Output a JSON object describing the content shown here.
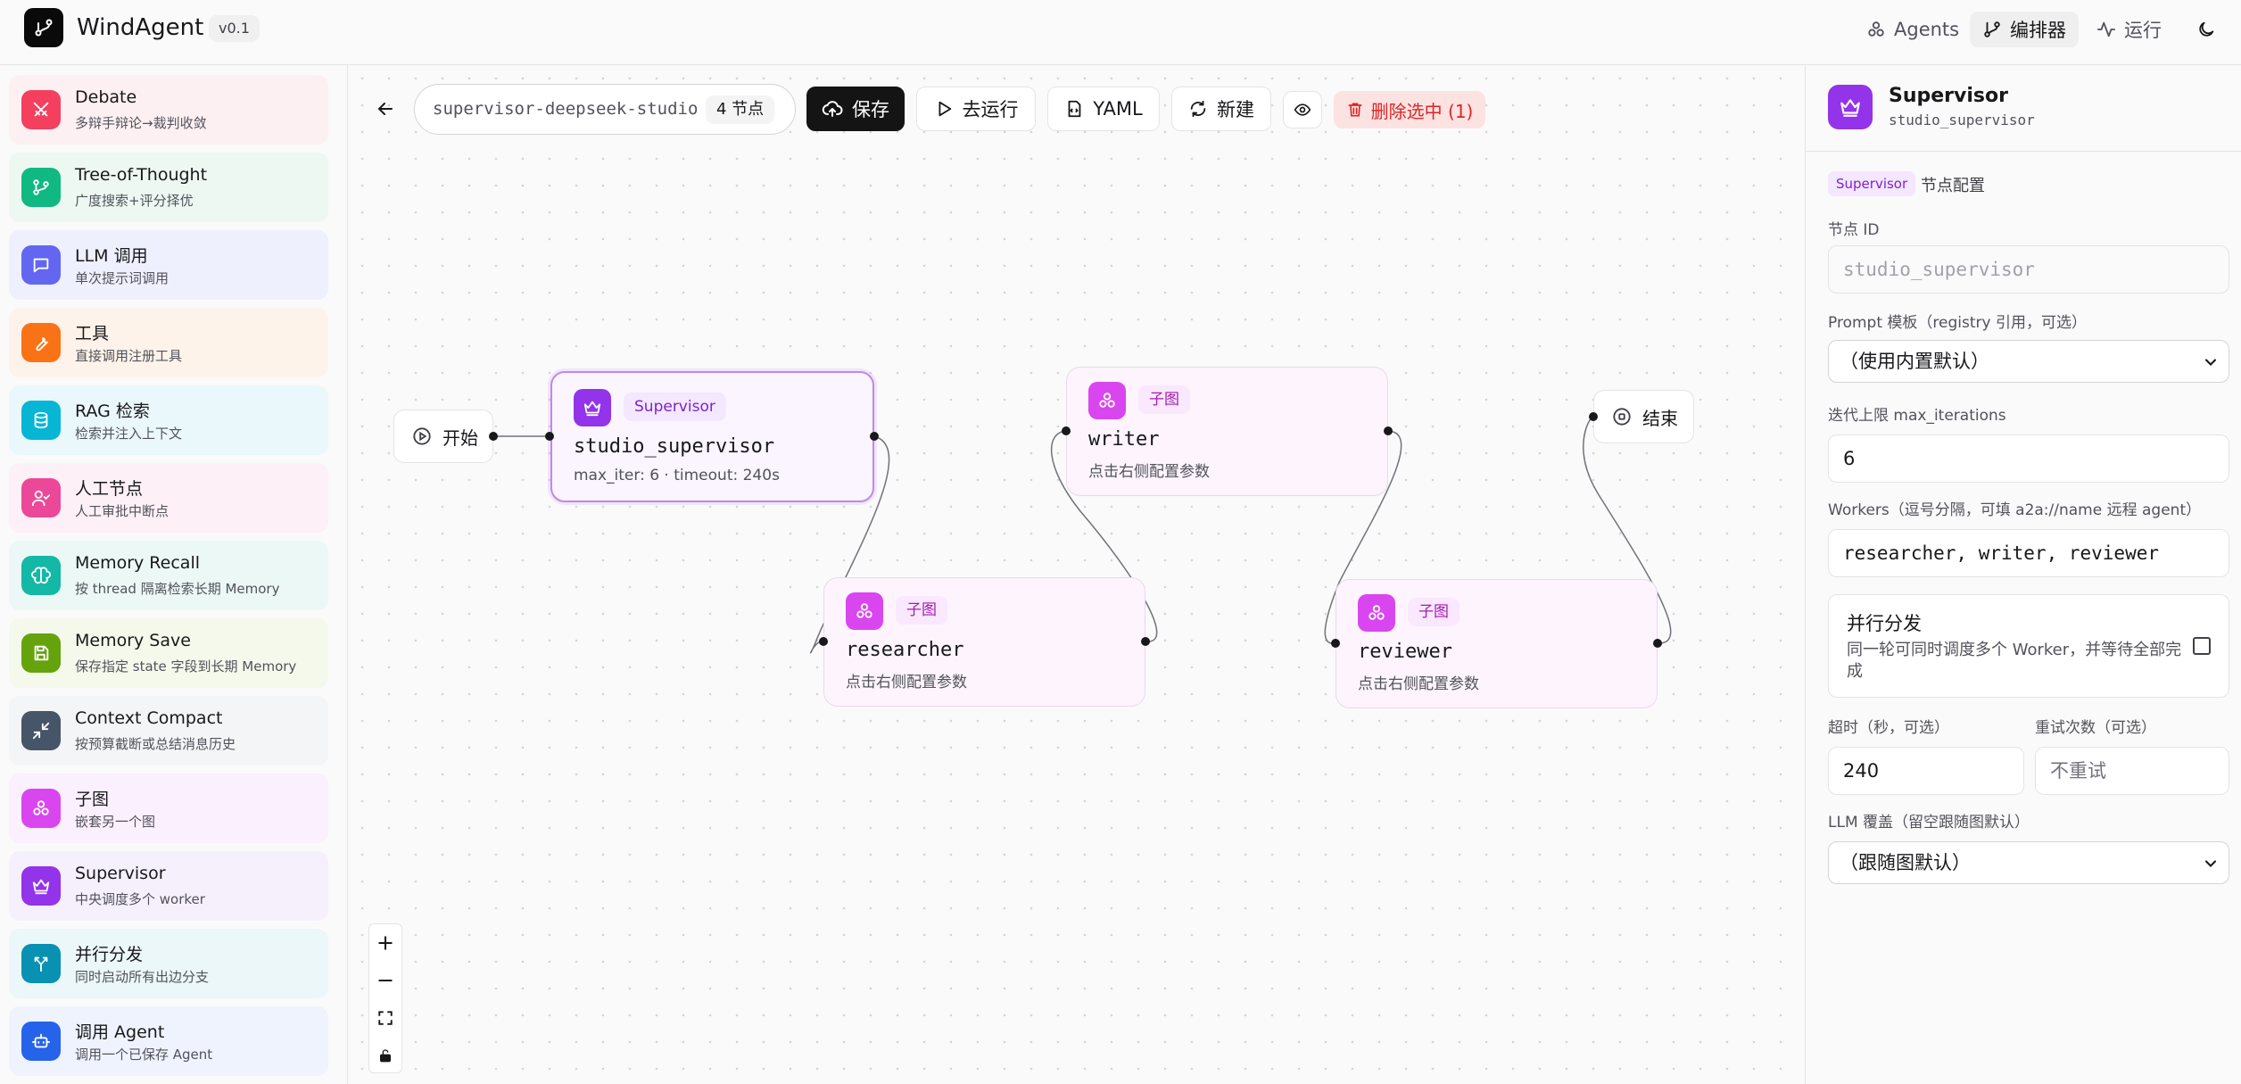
{
  "header": {
    "app_name": "WindAgent",
    "version": "v0.1",
    "nav": [
      {
        "label": "Agents",
        "icon": "agents-icon"
      },
      {
        "label": "编排器",
        "icon": "branch-icon",
        "active": true
      },
      {
        "label": "运行",
        "icon": "activity-icon"
      }
    ],
    "theme_icon": "moon-icon"
  },
  "sidebar": {
    "items": [
      {
        "title": "Debate",
        "subtitle": "多辩手辩论→裁判收敛",
        "icon": "swords-icon",
        "color": "#f43f5e"
      },
      {
        "title": "Tree-of-Thought",
        "subtitle": "广度搜索+评分择优",
        "icon": "branch-icon",
        "color": "#10b981"
      },
      {
        "title": "LLM 调用",
        "subtitle": "单次提示词调用",
        "icon": "message-icon",
        "color": "#6366f1"
      },
      {
        "title": "工具",
        "subtitle": "直接调用注册工具",
        "icon": "wrench-icon",
        "color": "#f97316"
      },
      {
        "title": "RAG 检索",
        "subtitle": "检索并注入上下文",
        "icon": "database-icon",
        "color": "#06b6d4"
      },
      {
        "title": "人工节点",
        "subtitle": "人工审批中断点",
        "icon": "user-check-icon",
        "color": "#ec4899"
      },
      {
        "title": "Memory Recall",
        "subtitle": "按 thread 隔离检索长期 Memory",
        "icon": "brain-icon",
        "color": "#14b8a6"
      },
      {
        "title": "Memory Save",
        "subtitle": "保存指定 state 字段到长期 Memory",
        "icon": "save-icon",
        "color": "#65a30d"
      },
      {
        "title": "Context Compact",
        "subtitle": "按预算截断或总结消息历史",
        "icon": "shrink-icon",
        "color": "#475569"
      },
      {
        "title": "子图",
        "subtitle": "嵌套另一个图",
        "icon": "subgraph-icon",
        "color": "#d946ef"
      },
      {
        "title": "Supervisor",
        "subtitle": "中央调度多个 worker",
        "icon": "crown-icon",
        "color": "#9333ea"
      },
      {
        "title": "并行分发",
        "subtitle": "同时启动所有出边分支",
        "icon": "split-icon",
        "color": "#0891b2"
      },
      {
        "title": "调用 Agent",
        "subtitle": "调用一个已保存 Agent",
        "icon": "bot-icon",
        "color": "#2563eb"
      }
    ]
  },
  "toolbar": {
    "graph_name": "supervisor-deepseek-studio",
    "node_count": "4 节点",
    "save_label": "保存",
    "run_label": "去运行",
    "yaml_label": "YAML",
    "new_label": "新建",
    "delete_label": "删除选中 (1)"
  },
  "graph": {
    "start_label": "开始",
    "end_label": "结束",
    "nodes": [
      {
        "badge": "Supervisor",
        "title": "studio_supervisor",
        "subtitle": "max_iter: 6 · timeout: 240s",
        "selected": true
      },
      {
        "badge": "子图",
        "title": "researcher",
        "subtitle": "点击右侧配置参数"
      },
      {
        "badge": "子图",
        "title": "writer",
        "subtitle": "点击右侧配置参数"
      },
      {
        "badge": "子图",
        "title": "reviewer",
        "subtitle": "点击右侧配置参数"
      }
    ]
  },
  "panel": {
    "title": "Supervisor",
    "subtitle": "studio_supervisor",
    "type_chip": "Supervisor",
    "section_label": "节点配置",
    "node_id_label": "节点 ID",
    "node_id_value": "studio_supervisor",
    "prompt_label": "Prompt 模板（registry 引用，可选）",
    "prompt_value": "（使用内置默认）",
    "max_iter_label": "迭代上限 max_iterations",
    "max_iter_value": "6",
    "workers_label": "Workers（逗号分隔，可填 a2a://name 远程 agent）",
    "workers_value": "researcher, writer, reviewer",
    "parallel_title": "并行分发",
    "parallel_desc": "同一轮可同时调度多个 Worker，并等待全部完成",
    "parallel_checked": false,
    "timeout_label": "超时（秒，可选）",
    "timeout_value": "240",
    "retry_label": "重试次数（可选）",
    "retry_placeholder": "不重试",
    "llm_label": "LLM 覆盖（留空跟随图默认）",
    "llm_value": "（跟随图默认）"
  }
}
